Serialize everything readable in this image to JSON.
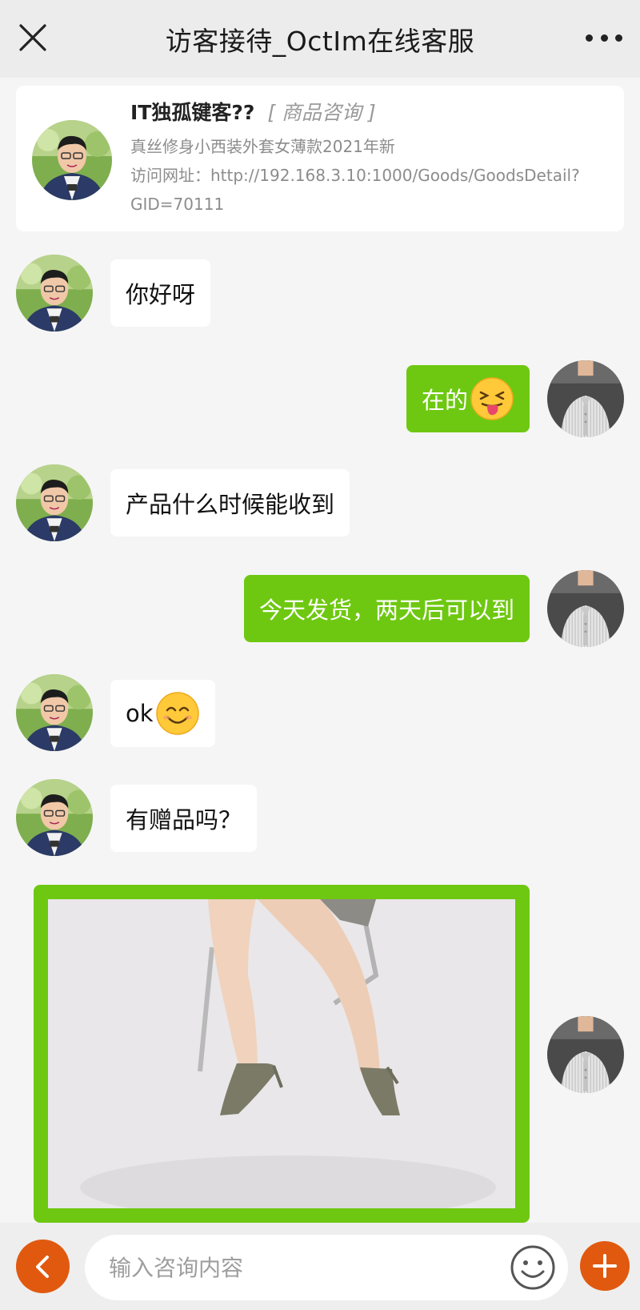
{
  "header": {
    "title": "访客接待_OctIm在线客服",
    "close_icon": "close-icon",
    "more_icon": "more-dots-icon"
  },
  "visitor": {
    "name": "IT独孤键客??",
    "tag": "[ 商品咨询 ]",
    "product": "真丝修身小西装外套女薄款2021年新",
    "url_line1": "访问网址：http://192.168.3.10:1000/Goods/GoodsDetail?",
    "url_line2": "GID=70111"
  },
  "messages": [
    {
      "from": "visitor",
      "text": "你好呀"
    },
    {
      "from": "agent",
      "text": "在的",
      "emoji": "tongue-out-emoji"
    },
    {
      "from": "visitor",
      "text": "产品什么时候能收到"
    },
    {
      "from": "agent",
      "text": "今天发货，两天后可以到"
    },
    {
      "from": "visitor",
      "text": "ok",
      "emoji": "smile-emoji"
    },
    {
      "from": "visitor",
      "text": "有赠品吗？"
    },
    {
      "from": "agent",
      "type": "image",
      "image": "product-photo-legs-heels"
    }
  ],
  "input": {
    "placeholder": "输入咨询内容",
    "value": "",
    "back_icon": "chevron-left-icon",
    "emoji_icon": "smiley-icon",
    "add_icon": "plus-icon"
  },
  "colors": {
    "accent_green": "#6ec811",
    "accent_orange": "#e0590f",
    "header_bg": "#ececec",
    "page_bg": "#f5f5f5"
  }
}
